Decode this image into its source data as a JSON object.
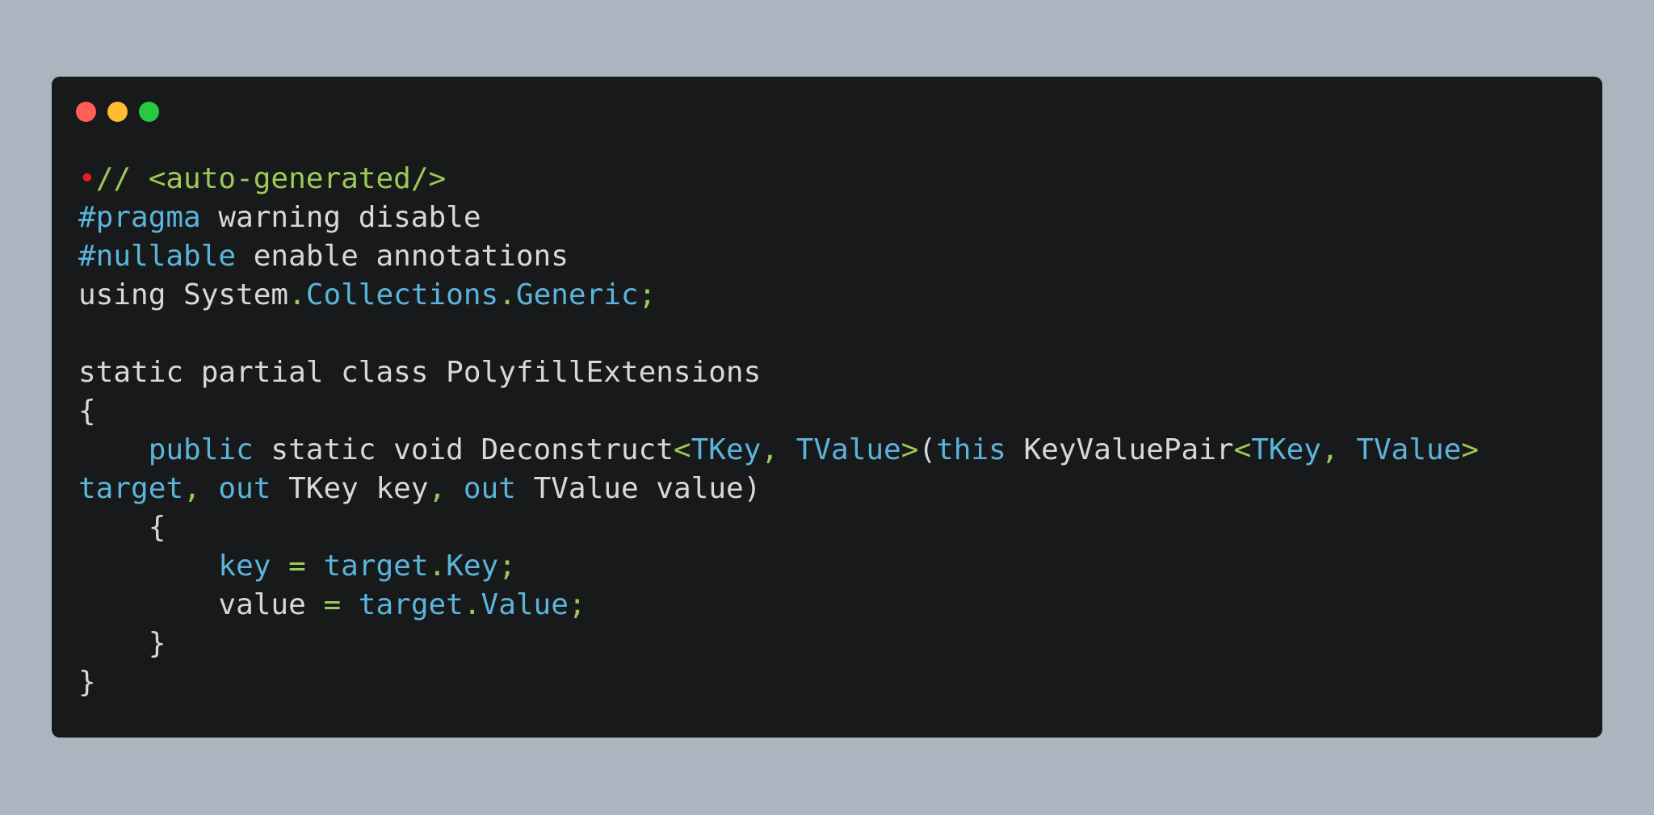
{
  "window": {
    "controls": [
      "close",
      "minimize",
      "maximize"
    ],
    "colors": {
      "background": "#abb5c0",
      "editor": "#18191b",
      "plain": "#d8d8d8",
      "keyword": "#5bb4da",
      "punctuation": "#9bca57",
      "close": "#ff5f57",
      "minimize": "#febc2e",
      "maximize": "#28c840"
    }
  },
  "code": {
    "lines": [
      [
        {
          "text": "•",
          "type": "dot"
        },
        {
          "text": "// <auto-generated/>",
          "type": "comment"
        }
      ],
      [
        {
          "text": "#pragma",
          "type": "key"
        },
        {
          "text": " warning disable",
          "type": "plain"
        }
      ],
      [
        {
          "text": "#nullable",
          "type": "key"
        },
        {
          "text": " enable annotations",
          "type": "plain"
        }
      ],
      [
        {
          "text": "using System",
          "type": "plain"
        },
        {
          "text": ".",
          "type": "punct"
        },
        {
          "text": "Collections",
          "type": "key"
        },
        {
          "text": ".",
          "type": "punct"
        },
        {
          "text": "Generic",
          "type": "key"
        },
        {
          "text": ";",
          "type": "punct"
        }
      ],
      [],
      [
        {
          "text": "static partial class PolyfillExtensions",
          "type": "plain"
        }
      ],
      [
        {
          "text": "{",
          "type": "plain"
        }
      ],
      [
        {
          "text": "    ",
          "type": "plain"
        },
        {
          "text": "public",
          "type": "key"
        },
        {
          "text": " static void Deconstruct",
          "type": "plain"
        },
        {
          "text": "<",
          "type": "punct"
        },
        {
          "text": "TKey",
          "type": "key"
        },
        {
          "text": ", ",
          "type": "punct"
        },
        {
          "text": "TValue",
          "type": "key"
        },
        {
          "text": ">",
          "type": "punct"
        },
        {
          "text": "(",
          "type": "plain"
        },
        {
          "text": "this",
          "type": "key"
        },
        {
          "text": " KeyValuePair",
          "type": "plain"
        },
        {
          "text": "<",
          "type": "punct"
        },
        {
          "text": "TKey",
          "type": "key"
        },
        {
          "text": ", ",
          "type": "punct"
        },
        {
          "text": "TValue",
          "type": "key"
        },
        {
          "text": ">",
          "type": "punct"
        }
      ],
      [
        {
          "text": "target",
          "type": "key"
        },
        {
          "text": ", ",
          "type": "punct"
        },
        {
          "text": "out",
          "type": "key"
        },
        {
          "text": " TKey key",
          "type": "plain"
        },
        {
          "text": ", ",
          "type": "punct"
        },
        {
          "text": "out",
          "type": "key"
        },
        {
          "text": " TValue value)",
          "type": "plain"
        }
      ],
      [
        {
          "text": "    {",
          "type": "plain"
        }
      ],
      [
        {
          "text": "        ",
          "type": "plain"
        },
        {
          "text": "key",
          "type": "key"
        },
        {
          "text": " = ",
          "type": "punct"
        },
        {
          "text": "target",
          "type": "key"
        },
        {
          "text": ".",
          "type": "punct"
        },
        {
          "text": "Key",
          "type": "key"
        },
        {
          "text": ";",
          "type": "punct"
        }
      ],
      [
        {
          "text": "        value",
          "type": "plain"
        },
        {
          "text": " = ",
          "type": "punct"
        },
        {
          "text": "target",
          "type": "key"
        },
        {
          "text": ".",
          "type": "punct"
        },
        {
          "text": "Value",
          "type": "key"
        },
        {
          "text": ";",
          "type": "punct"
        }
      ],
      [
        {
          "text": "    }",
          "type": "plain"
        }
      ],
      [
        {
          "text": "}",
          "type": "plain"
        }
      ]
    ]
  }
}
